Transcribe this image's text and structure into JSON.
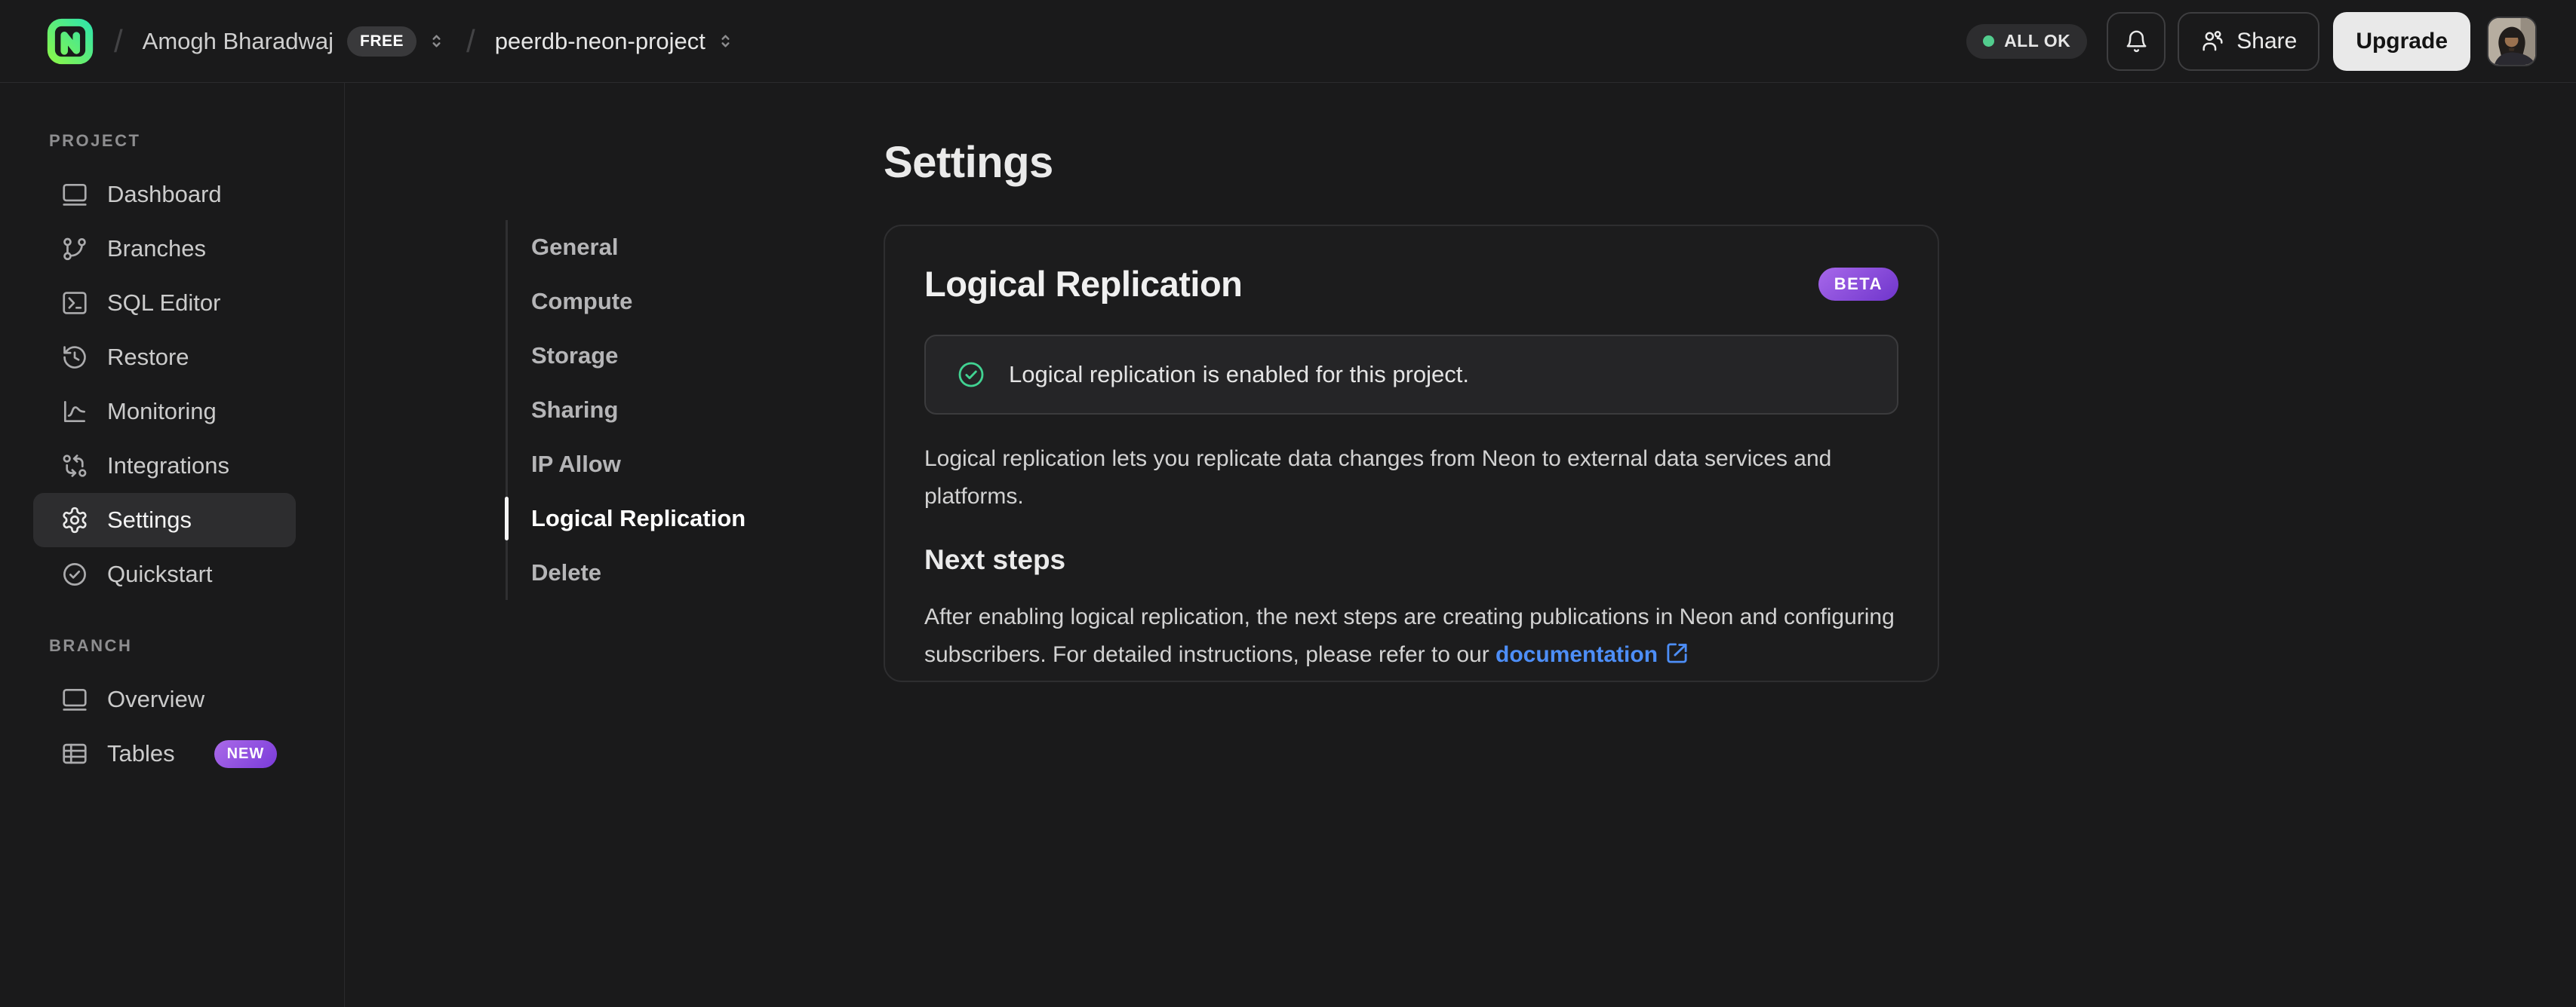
{
  "topbar": {
    "breadcrumb": {
      "separator": "/",
      "org": "Amogh Bharadwaj",
      "org_badge": "FREE",
      "project": "peerdb-neon-project"
    },
    "status_pill": "ALL OK",
    "share_label": "Share",
    "upgrade_label": "Upgrade",
    "icons": {
      "logo": "neon-logo",
      "org_selector": "chevrons-up-down-icon",
      "project_selector": "chevrons-up-down-icon",
      "status_dot": "green-status-dot",
      "notifications": "bell-icon",
      "share": "users-icon",
      "avatar": "user-avatar-photo"
    }
  },
  "sidebar": {
    "sections": [
      {
        "label": "PROJECT",
        "items": [
          {
            "label": "Dashboard",
            "icon": "dashboard-icon"
          },
          {
            "label": "Branches",
            "icon": "git-branch-icon"
          },
          {
            "label": "SQL Editor",
            "icon": "sql-terminal-icon"
          },
          {
            "label": "Restore",
            "icon": "history-icon"
          },
          {
            "label": "Monitoring",
            "icon": "line-chart-icon"
          },
          {
            "label": "Integrations",
            "icon": "integrations-icon"
          },
          {
            "label": "Settings",
            "icon": "gear-icon",
            "active": true
          },
          {
            "label": "Quickstart",
            "icon": "check-circle-icon"
          }
        ]
      },
      {
        "label": "BRANCH",
        "items": [
          {
            "label": "Overview",
            "icon": "window-icon"
          },
          {
            "label": "Tables",
            "icon": "table-icon",
            "badge": "NEW"
          }
        ]
      }
    ]
  },
  "main": {
    "title": "Settings",
    "nav": [
      {
        "label": "General"
      },
      {
        "label": "Compute"
      },
      {
        "label": "Storage"
      },
      {
        "label": "Sharing"
      },
      {
        "label": "IP Allow"
      },
      {
        "label": "Logical Replication",
        "active": true
      },
      {
        "label": "Delete"
      }
    ],
    "card": {
      "title": "Logical Replication",
      "badge": "BETA",
      "alert_text": "Logical replication is enabled for this project.",
      "description": "Logical replication lets you replicate data changes from Neon to external data services and platforms.",
      "next_steps_heading": "Next steps",
      "next_steps_text": "After enabling logical replication, the next steps are creating publications in Neon and configuring subscribers. For detailed instructions, please refer to our ",
      "doc_link_label": "documentation"
    }
  },
  "colors": {
    "page_bg": "#1a1a1b",
    "card_bg": "#1c1c1d",
    "border": "#2e2e30",
    "alert_bg": "#252527",
    "selected_item_bg": "#2d2d2f",
    "status_green": "#52cd8e",
    "check_green": "#41d392",
    "link_blue": "#4d8ef7",
    "badge_purple_start": "#a768ea",
    "badge_purple_end": "#6f35cc",
    "upgrade_bg": "#e9e9e9",
    "logo_teal": "#2fe4ac",
    "logo_green": "#86f54d"
  }
}
